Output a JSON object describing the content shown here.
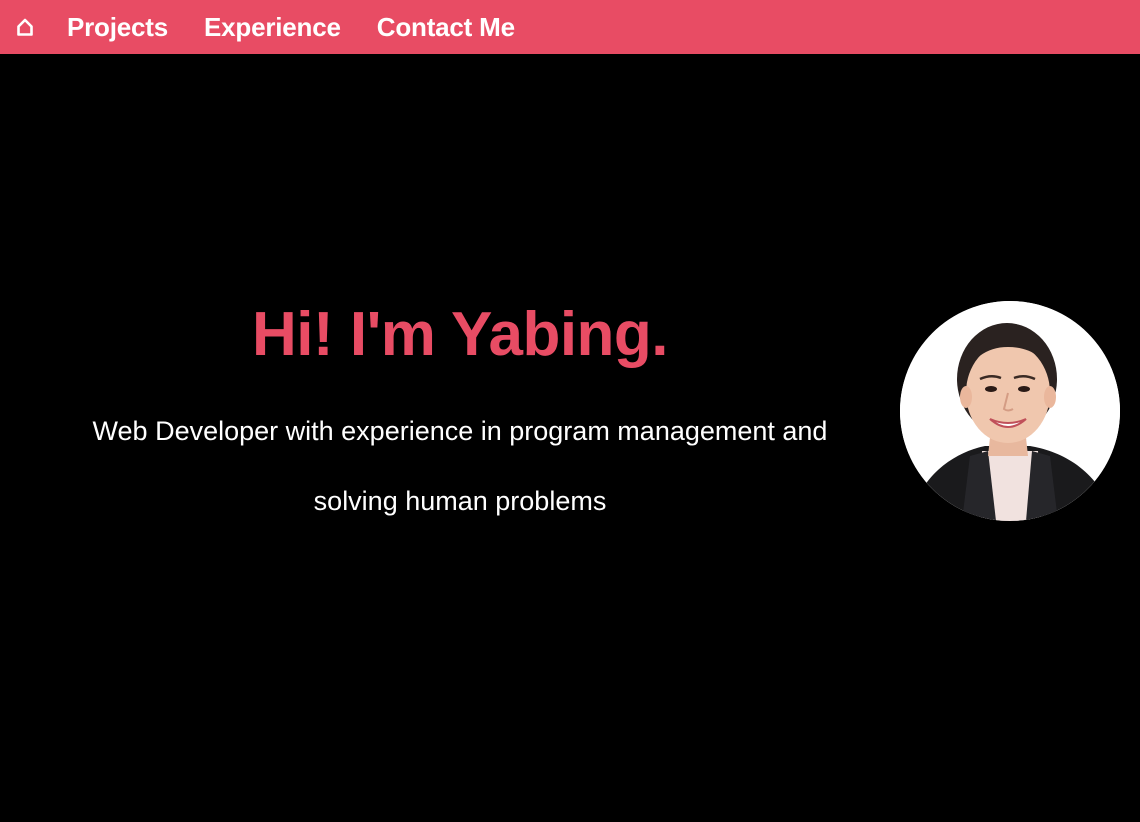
{
  "nav": {
    "home_icon": "home-icon",
    "links": [
      {
        "label": "Projects"
      },
      {
        "label": "Experience"
      },
      {
        "label": "Contact Me"
      }
    ]
  },
  "hero": {
    "title": "Hi! I'm Yabing.",
    "subtitle": "Web Developer with experience in program management and solving human problems"
  },
  "colors": {
    "accent": "#e84c64",
    "background": "#000000",
    "text": "#ffffff"
  }
}
